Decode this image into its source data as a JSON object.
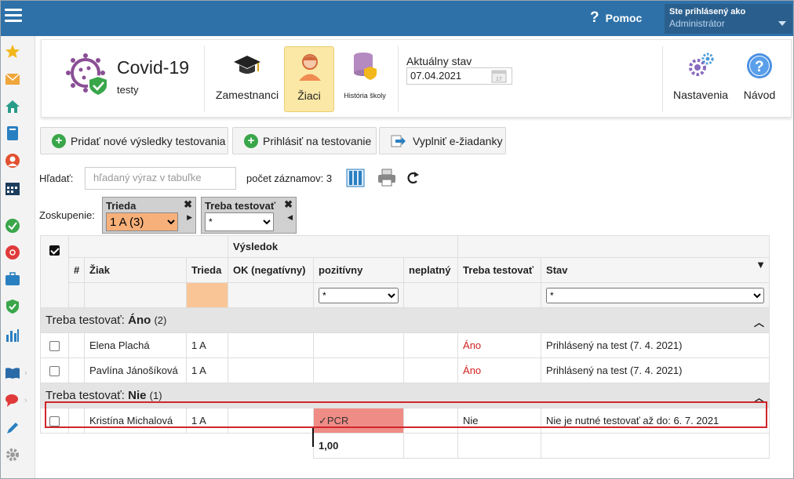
{
  "topbar": {
    "help_label": "Pomoc",
    "user_line1": "Ste prihlásený ako",
    "user_name": "Administrátor"
  },
  "app": {
    "title": "Covid-19",
    "subtitle": "testy"
  },
  "header_buttons": [
    {
      "label": "Zamestnanci",
      "icon": "mortarboard-icon"
    },
    {
      "label": "Žiaci",
      "icon": "student-icon",
      "active": true
    },
    {
      "label": "História školy",
      "icon": "database-shield-icon"
    }
  ],
  "state": {
    "label": "Aktuálny stav",
    "date": "07.04.2021"
  },
  "settings_label": "Nastavenia",
  "guide_label": "Návod",
  "actions": {
    "add_results": "Pridať nové výsledky testovania",
    "register": "Prihlásiť na testovanie",
    "fill_request": "Vyplniť e-žiadanky"
  },
  "search": {
    "label": "Hľadať:",
    "placeholder": "hľadaný výraz v tabuľke",
    "count_text": "počet záznamov: 3"
  },
  "grouping": {
    "label": "Zoskupenie:",
    "chip1": {
      "title": "Trieda",
      "value": "1 A (3)"
    },
    "chip2": {
      "title": "Treba testovať",
      "value": "*"
    }
  },
  "table": {
    "col_num": "#",
    "col_student": "Žiak",
    "col_class": "Trieda",
    "group_result": "Výsledok",
    "col_ok": "OK (negatívny)",
    "col_positive": "pozitívny",
    "col_invalid": "neplatný",
    "col_need": "Treba testovať",
    "col_status": "Stav",
    "filter_value": "*",
    "group1": {
      "prefix": "Treba testovať: ",
      "value": "Áno",
      "count": "(2)"
    },
    "group2": {
      "prefix": "Treba testovať: ",
      "value": "Nie",
      "count": "(1)"
    },
    "rows": [
      {
        "name": "Elena Plachá",
        "class": "1 A",
        "positive": "",
        "need": "Áno",
        "status": "Prihlásený na test (7. 4. 2021)"
      },
      {
        "name": "Pavlína Jánošíková",
        "class": "1 A",
        "positive": "",
        "need": "Áno",
        "status": "Prihlásený na test (7. 4. 2021)"
      },
      {
        "name": "Kristína Michalová",
        "class": "1 A",
        "positive": "✓PCR",
        "need": "Nie",
        "status": "Nie je nutné testovať až do: 6. 7. 2021"
      }
    ],
    "sum": "1,00"
  },
  "colors": {
    "topbar": "#2e71a8",
    "active_button": "#fbe8a6",
    "positive_cell": "#f08c86",
    "highlight": "#d0262c",
    "need_yes": "#d22020"
  }
}
